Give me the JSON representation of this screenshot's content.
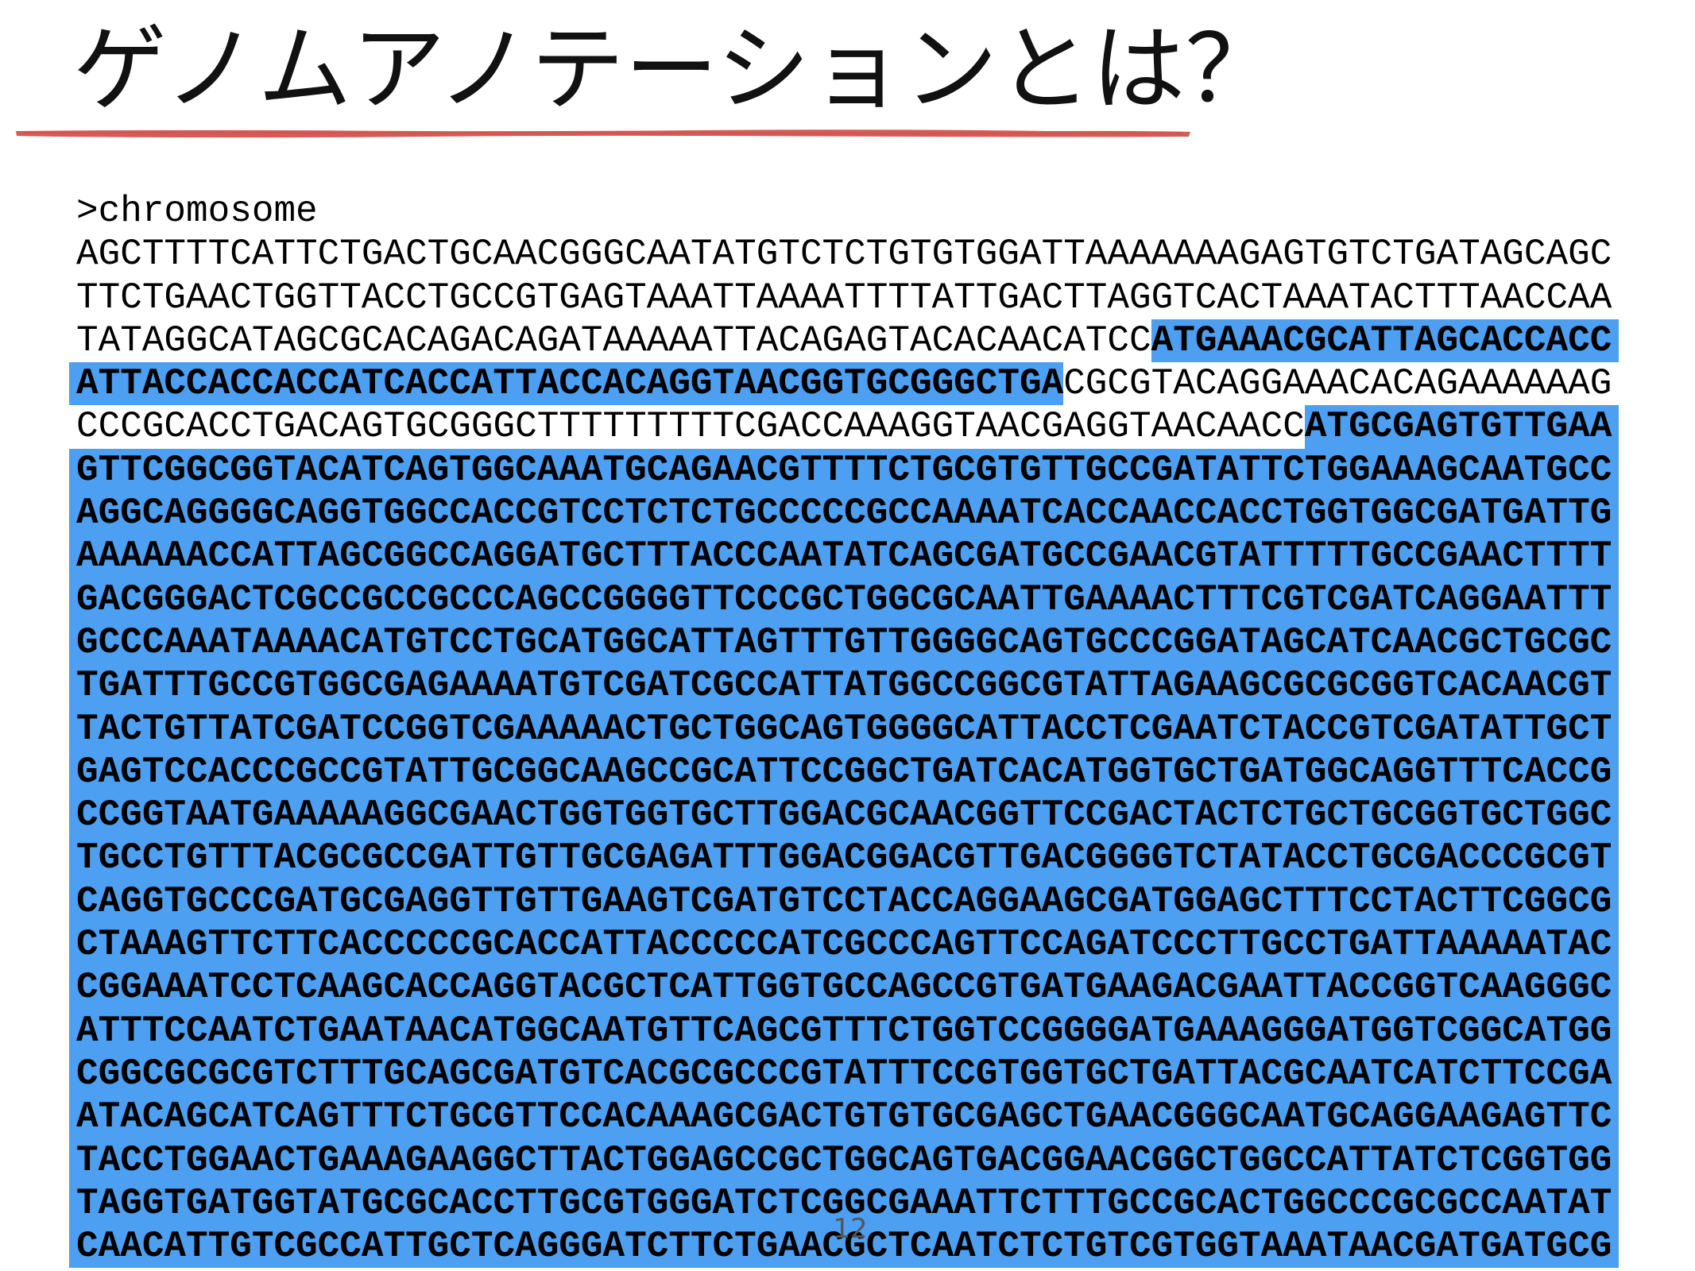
{
  "slide": {
    "title": "ゲノムアノテーションとは？",
    "page_number": "12"
  },
  "colors": {
    "highlight": "#4d9ff2",
    "underline": "#d65a55",
    "text": "#000000"
  },
  "sequence": {
    "header": ">chromosome",
    "lines": [
      [
        {
          "text": "AGCTTTTCATTCTGACTGCAACGGGCAATATGTCTCTGTGTGGATTAAAAAAAGAGTGTCTGATAGCAGC",
          "highlight": false
        }
      ],
      [
        {
          "text": "TTCTGAACTGGTTACCTGCCGTGAGTAAATTAAAATTTTATTGACTTAGGTCACTAAATACTTTAACCAA",
          "highlight": false
        }
      ],
      [
        {
          "text": "TATAGGCATAGCGCACAGACAGATAAAAATTACAGAGTACACAACATCC",
          "highlight": false
        },
        {
          "text": "ATGAAACGCATTAGCACCACC",
          "highlight": true
        }
      ],
      [
        {
          "text": "ATTACCACCACCATCACCATTACCACAGGTAACGGTGCGGGCTGA",
          "highlight": true
        },
        {
          "text": "CGCGTACAGGAAACACAGAAAAAAG",
          "highlight": false
        }
      ],
      [
        {
          "text": "CCCGCACCTGACAGTGCGGGCTTTTTTTTTCGACCAAAGGTAACGAGGTAACAACC",
          "highlight": false
        },
        {
          "text": "ATGCGAGTGTTGAA",
          "highlight": true
        }
      ],
      [
        {
          "text": "GTTCGGCGGTACATCAGTGGCAAATGCAGAACGTTTTCTGCGTGTTGCCGATATTCTGGAAAGCAATGCC",
          "highlight": true
        }
      ],
      [
        {
          "text": "AGGCAGGGGCAGGTGGCCACCGTCCTCTCTGCCCCCGCCAAAATCACCAACCACCTGGTGGCGATGATTG",
          "highlight": true
        }
      ],
      [
        {
          "text": "AAAAAACCATTAGCGGCCAGGATGCTTTACCCAATATCAGCGATGCCGAACGTATTTTTGCCGAACTTTT",
          "highlight": true
        }
      ],
      [
        {
          "text": "GACGGGACTCGCCGCCGCCCAGCCGGGGTTCCCGCTGGCGCAATTGAAAACTTTCGTCGATCAGGAATTT",
          "highlight": true
        }
      ],
      [
        {
          "text": "GCCCAAATAAAACATGTCCTGCATGGCATTAGTTTGTTGGGGCAGTGCCCGGATAGCATCAACGCTGCGC",
          "highlight": true
        }
      ],
      [
        {
          "text": "TGATTTGCCGTGGCGAGAAAATGTCGATCGCCATTATGGCCGGCGTATTAGAAGCGCGCGGTCACAACGT",
          "highlight": true
        }
      ],
      [
        {
          "text": "TACTGTTATCGATCCGGTCGAAAAACTGCTGGCAGTGGGGCATTACCTCGAATCTACCGTCGATATTGCT",
          "highlight": true
        }
      ],
      [
        {
          "text": "GAGTCCACCCGCCGTATTGCGGCAAGCCGCATTCCGGCTGATCACATGGTGCTGATGGCAGGTTTCACCG",
          "highlight": true
        }
      ],
      [
        {
          "text": "CCGGTAATGAAAAAGGCGAACTGGTGGTGCTTGGACGCAACGGTTCCGACTACTCTGCTGCGGTGCTGGC",
          "highlight": true
        }
      ],
      [
        {
          "text": "TGCCTGTTTACGCGCCGATTGTTGCGAGATTTGGACGGACGTTGACGGGGTCTATACCTGCGACCCGCGT",
          "highlight": true
        }
      ],
      [
        {
          "text": "CAGGTGCCCGATGCGAGGTTGTTGAAGTCGATGTCCTACCAGGAAGCGATGGAGCTTTCCTACTTCGGCG",
          "highlight": true
        }
      ],
      [
        {
          "text": "CTAAAGTTCTTCACCCCCGCACCATTACCCCCATCGCCCAGTTCCAGATCCCTTGCCTGATTAAAAATAC",
          "highlight": true
        }
      ],
      [
        {
          "text": "CGGAAATCCTCAAGCACCAGGTACGCTCATTGGTGCCAGCCGTGATGAAGACGAATTACCGGTCAAGGGC",
          "highlight": true
        }
      ],
      [
        {
          "text": "ATTTCCAATCTGAATAACATGGCAATGTTCAGCGTTTCTGGTCCGGGGATGAAAGGGATGGTCGGCATGG",
          "highlight": true
        }
      ],
      [
        {
          "text": "CGGCGCGCGTCTTTGCAGCGATGTCACGCGCCCGTATTTCCGTGGTGCTGATTACGCAATCATCTTCCGA",
          "highlight": true
        }
      ],
      [
        {
          "text": "ATACAGCATCAGTTTCTGCGTTCCACAAAGCGACTGTGTGCGAGCTGAACGGGCAATGCAGGAAGAGTTC",
          "highlight": true
        }
      ],
      [
        {
          "text": "TACCTGGAACTGAAAGAAGGCTTACTGGAGCCGCTGGCAGTGACGGAACGGCTGGCCATTATCTCGGTGG",
          "highlight": true
        }
      ],
      [
        {
          "text": "TAGGTGATGGTATGCGCACCTTGCGTGGGATCTCGGCGAAATTCTTTGCCGCACTGGCCCGCGCCAATAT",
          "highlight": true
        }
      ],
      [
        {
          "text": "CAACATTGTCGCCATTGCTCAGGGATCTTCTGAACGCTCAATCTCTGTCGTGGTAAATAACGATGATGCG",
          "highlight": true
        }
      ]
    ]
  }
}
